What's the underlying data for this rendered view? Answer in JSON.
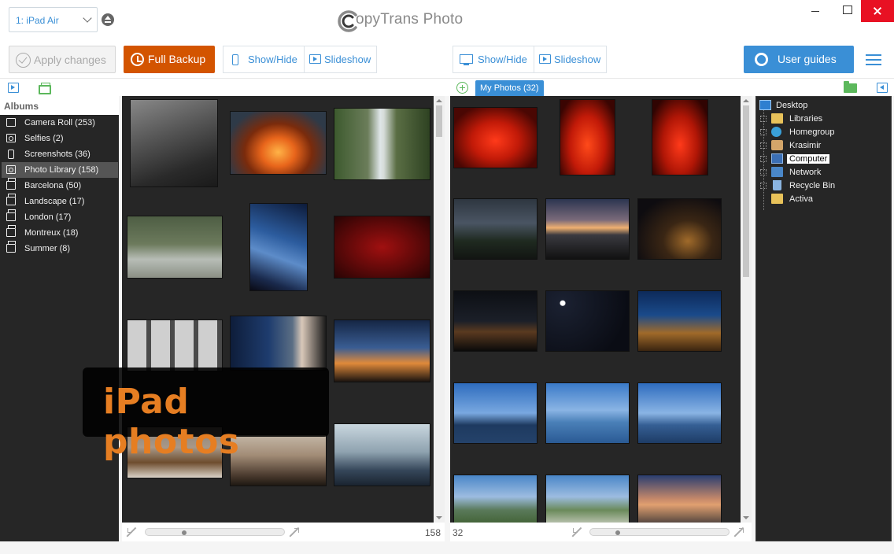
{
  "device": {
    "selected": "1: iPad Air"
  },
  "app": {
    "title": "CopyTrans Photo",
    "title_suffix": "opyTrans Photo"
  },
  "toolbar": {
    "apply_label": "Apply changes",
    "backup_label": "Full Backup",
    "left_showhide": "Show/Hide",
    "left_slideshow": "Slideshow",
    "right_showhide": "Show/Hide",
    "right_slideshow": "Slideshow",
    "guides_label": "User guides"
  },
  "albums": {
    "header": "Albums",
    "items": [
      {
        "label": "Camera Roll (253)",
        "icon": "camera-roll-icon"
      },
      {
        "label": "Selfies (2)",
        "icon": "camera-icon"
      },
      {
        "label": "Screenshots (36)",
        "icon": "phone-icon"
      },
      {
        "label": "Photo Library (158)",
        "icon": "camera-icon"
      },
      {
        "label": "Barcelona (50)",
        "icon": "album-icon"
      },
      {
        "label": "Landscape (17)",
        "icon": "album-icon"
      },
      {
        "label": "London (17)",
        "icon": "album-icon"
      },
      {
        "label": "Montreux (18)",
        "icon": "album-icon"
      },
      {
        "label": "Summer (8)",
        "icon": "album-icon"
      }
    ],
    "selected_index": 3
  },
  "ipad_pane": {
    "overlay": "iPad photos",
    "count": "158"
  },
  "pc_pane": {
    "tab": "My Photos (32)",
    "count": "32"
  },
  "tree": {
    "items": [
      {
        "label": "Desktop",
        "icon": "desktop-icon"
      },
      {
        "label": "Libraries",
        "icon": "libraries-icon"
      },
      {
        "label": "Homegroup",
        "icon": "homegroup-icon"
      },
      {
        "label": "Krasimir",
        "icon": "user-folder-icon"
      },
      {
        "label": "Computer",
        "icon": "computer-icon"
      },
      {
        "label": "Network",
        "icon": "network-icon"
      },
      {
        "label": "Recycle Bin",
        "icon": "recycle-bin-icon"
      },
      {
        "label": "Activa",
        "icon": "folder-icon"
      }
    ],
    "selected": "Computer"
  },
  "colors": {
    "accent": "#3a8fd6",
    "backup": "#d35400",
    "overlay_text": "#e67e22",
    "green": "#5cb85c"
  }
}
